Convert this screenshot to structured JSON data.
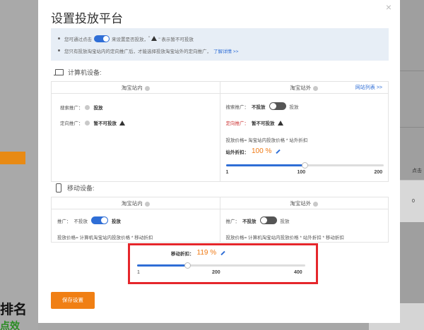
{
  "background": {
    "left_heading": "排名",
    "left_sub": "点效",
    "right_label": "点击",
    "right_value": "0"
  },
  "dialog": {
    "title": "设置投放平台",
    "close_label": "×",
    "notice": {
      "line1_prefix": "您可通过点击",
      "line1_middle": "来设置是否投放，",
      "line1_quote_open": "\"",
      "line1_quote_close": "\" 表示暂不可投放",
      "line2": "您只有投放淘宝站内的定向推广后，才能选择投放淘宝站外的定向推广，",
      "line2_link": "了解详情 >>"
    },
    "computer": {
      "heading": "计算机设备:",
      "inner": {
        "header": "淘宝站内",
        "search_label": "搜索推广：",
        "search_value": "投放",
        "targeted_label": "定向推广：",
        "targeted_value": "暂不可投放"
      },
      "outer": {
        "header": "淘宝站外",
        "header_link": "网站列表 >>",
        "search_label": "搜索推广：",
        "search_off": "不投放",
        "search_on": "投放",
        "targeted_label": "定向推广：",
        "targeted_value": "暂不可投放",
        "price_formula": "投放价格= 淘宝站内投放价格 * 站外折扣",
        "discount_label": "站外折扣：",
        "discount_value": "100 %",
        "slider": {
          "min": "1",
          "mid": "100",
          "max": "200",
          "value": 100,
          "range": [
            1,
            200
          ]
        }
      }
    },
    "mobile": {
      "heading": "移动设备:",
      "inner": {
        "header": "淘宝站内",
        "promo_label": "推广：",
        "off_label": "不投放",
        "on_label": "投放",
        "price_formula": "投放价格= 计算机淘宝站内投放价格 * 移动折扣"
      },
      "outer": {
        "header": "淘宝站外",
        "promo_label": "推广：",
        "off_label": "不投放",
        "on_label": "投放",
        "price_formula": "投放价格= 计算机淘宝站内投放价格 * 站外折扣 * 移动折扣"
      },
      "discount_label": "移动折扣：",
      "discount_value": "119 %",
      "slider": {
        "min": "1",
        "mid": "200",
        "max": "400",
        "value": 119,
        "range": [
          1,
          400
        ]
      }
    },
    "save_button": "保存设置"
  },
  "colors": {
    "accent_blue": "#2f6ed6",
    "orange": "#f07f14",
    "highlight_red": "#e5262b"
  }
}
